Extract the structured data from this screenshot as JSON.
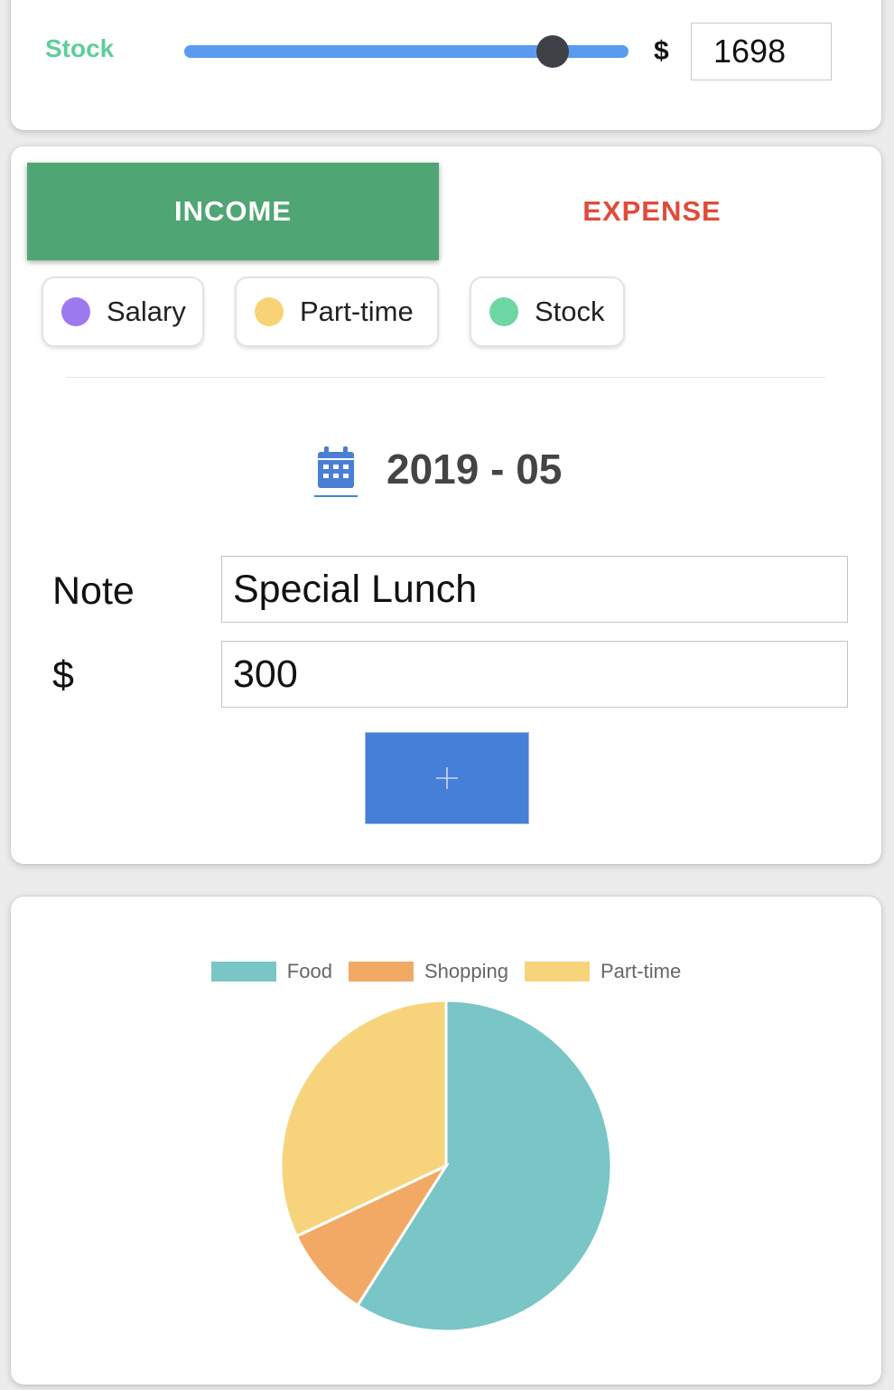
{
  "slider": {
    "label": "Stock",
    "value_fraction": 0.83,
    "currency": "$",
    "amount": "1698"
  },
  "tabs": [
    {
      "label": "INCOME",
      "active": true
    },
    {
      "label": "EXPENSE",
      "active": false
    }
  ],
  "categories": [
    {
      "label": "Salary",
      "color": "#9d79ef"
    },
    {
      "label": "Part-time",
      "color": "#f7d376"
    },
    {
      "label": "Stock",
      "color": "#6ed6a4"
    }
  ],
  "date": {
    "icon": "calendar-icon",
    "text": "2019 - 05"
  },
  "form": {
    "note_label": "Note",
    "note_value": "Special Lunch",
    "amount_label": "$",
    "amount_value": "300",
    "add_icon": "plus-icon"
  },
  "colors": {
    "income": "#4fa574",
    "expense": "#e04c3a",
    "accent": "#467fd8"
  },
  "chart_data": {
    "type": "pie",
    "title": "",
    "legend_position": "top",
    "categories": [
      "Food",
      "Shopping",
      "Part-time"
    ],
    "values": [
      59,
      9,
      32
    ],
    "colors": [
      "#7ac5c5",
      "#f2a966",
      "#f7d47c"
    ]
  }
}
